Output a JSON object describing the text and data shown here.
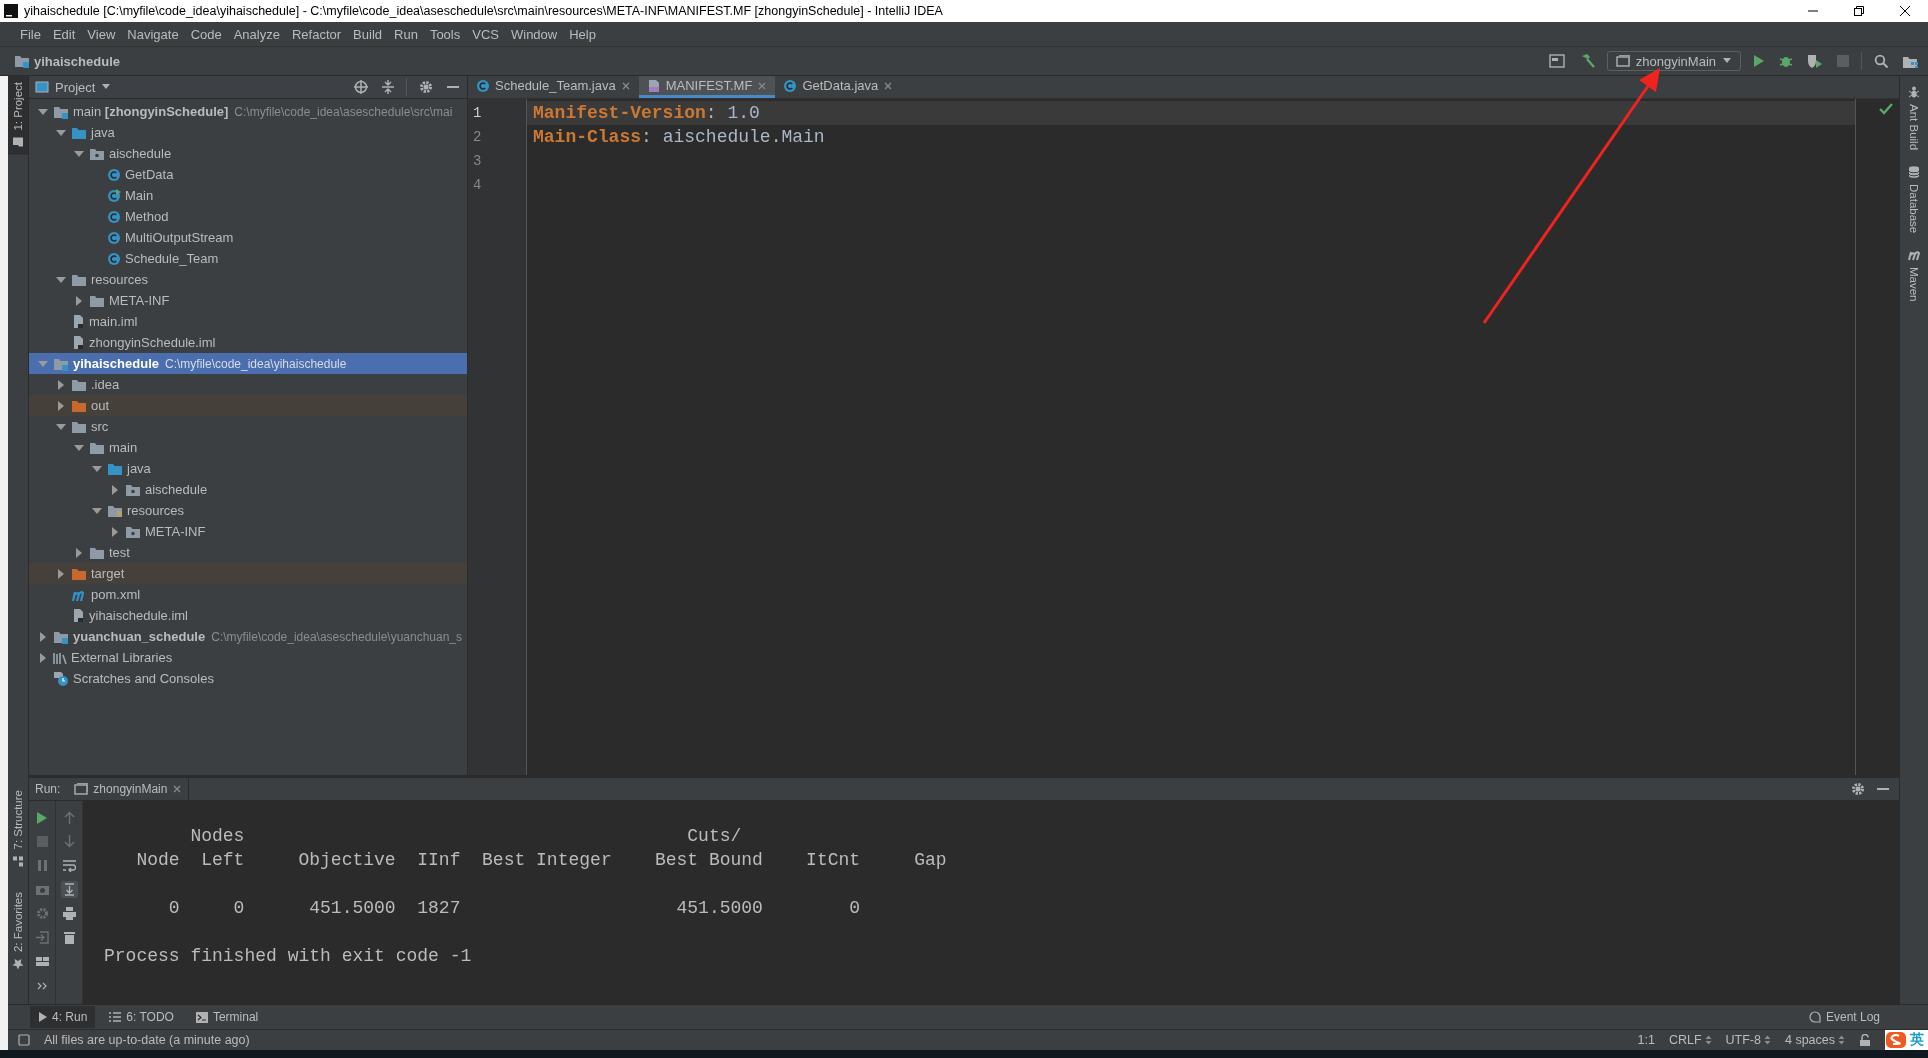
{
  "window": {
    "title": "yihaischedule [C:\\myfile\\code_idea\\yihaischedule] - C:\\myfile\\code_idea\\aseschedule\\src\\main\\resources\\META-INF\\MANIFEST.MF [zhongyinSchedule] - IntelliJ IDEA"
  },
  "menu": [
    "File",
    "Edit",
    "View",
    "Navigate",
    "Code",
    "Analyze",
    "Refactor",
    "Build",
    "Run",
    "Tools",
    "VCS",
    "Window",
    "Help"
  ],
  "nav_bar": {
    "project": "yihaischedule",
    "run_config": "zhongyinMain"
  },
  "left_tool_strip": [
    {
      "label": "1: Project",
      "selected": true,
      "kind": "project"
    },
    {
      "label": "7: Structure",
      "selected": false,
      "kind": "structure"
    },
    {
      "label": "2: Favorites",
      "selected": false,
      "kind": "favorites"
    }
  ],
  "project_panel": {
    "title": "Project",
    "tree": [
      {
        "label": "main **[zhongyinSchedule]**",
        "bold": false,
        "path": "C:\\myfile\\code_idea\\aseschedule\\src\\mai",
        "kind": "module",
        "expanded": true,
        "selected": false,
        "children": [
          {
            "label": "java",
            "kind": "source-folder",
            "expanded": true,
            "selected": false,
            "children": [
              {
                "label": "aischedule",
                "kind": "package",
                "expanded": true,
                "selected": false,
                "children": [
                  {
                    "label": "GetData",
                    "kind": "class",
                    "selected": false
                  },
                  {
                    "label": "Main",
                    "kind": "main-class",
                    "selected": false
                  },
                  {
                    "label": "Method",
                    "kind": "class",
                    "selected": false
                  },
                  {
                    "label": "MultiOutputStream",
                    "kind": "class",
                    "selected": false
                  },
                  {
                    "label": "Schedule_Team",
                    "kind": "class",
                    "selected": false
                  }
                ]
              }
            ]
          },
          {
            "label": "resources",
            "kind": "folder",
            "expanded": true,
            "selected": false,
            "children": [
              {
                "label": "META-INF",
                "kind": "folder",
                "expanded": false,
                "selected": false
              }
            ]
          },
          {
            "label": "main.iml",
            "kind": "iml",
            "selected": false
          },
          {
            "label": "zhongyinSchedule.iml",
            "kind": "iml",
            "selected": false
          }
        ]
      },
      {
        "label": "yihaischedule",
        "bold": true,
        "path": "C:\\myfile\\code_idea\\yihaischedule",
        "kind": "module",
        "expanded": true,
        "selected": true,
        "children": [
          {
            "label": ".idea",
            "kind": "folder",
            "expanded": false,
            "selected": false
          },
          {
            "label": "out",
            "kind": "excluded-folder",
            "expanded": false,
            "selected": false
          },
          {
            "label": "src",
            "kind": "folder",
            "expanded": true,
            "selected": false,
            "children": [
              {
                "label": "main",
                "kind": "folder",
                "expanded": true,
                "selected": false,
                "children": [
                  {
                    "label": "java",
                    "kind": "source-folder",
                    "expanded": true,
                    "selected": false,
                    "children": [
                      {
                        "label": "aischedule",
                        "kind": "package",
                        "expanded": false,
                        "selected": false
                      }
                    ]
                  },
                  {
                    "label": "resources",
                    "kind": "resources-folder",
                    "expanded": true,
                    "selected": false,
                    "children": [
                      {
                        "label": "META-INF",
                        "kind": "package",
                        "expanded": false,
                        "selected": false
                      }
                    ]
                  }
                ]
              },
              {
                "label": "test",
                "kind": "folder",
                "expanded": false,
                "selected": false
              }
            ]
          },
          {
            "label": "target",
            "kind": "excluded-folder",
            "expanded": false,
            "selected": false
          },
          {
            "label": "pom.xml",
            "kind": "maven",
            "selected": false
          },
          {
            "label": "yihaischedule.iml",
            "kind": "iml",
            "selected": false
          }
        ]
      },
      {
        "label": "yuanchuan_schedule",
        "bold": true,
        "path": "C:\\myfile\\code_idea\\aseschedule\\yuanchuan_s",
        "kind": "module",
        "expanded": false,
        "selected": false
      },
      {
        "label": "External Libraries",
        "kind": "libraries",
        "expanded": false,
        "selected": false
      },
      {
        "label": "Scratches and Consoles",
        "kind": "scratches",
        "selected": false
      }
    ]
  },
  "editor": {
    "tabs": [
      {
        "label": "Schedule_Team.java",
        "kind": "class",
        "selected": false
      },
      {
        "label": "MANIFEST.MF",
        "kind": "manifest",
        "selected": true
      },
      {
        "label": "GetData.java",
        "kind": "class",
        "selected": false
      }
    ],
    "lines": [
      {
        "number": "1",
        "key": "Manifest-Version",
        "rest": ": 1.0",
        "current": true
      },
      {
        "number": "2",
        "key": "Main-Class",
        "rest": ": aischedule.Main",
        "current": false
      },
      {
        "number": "3",
        "current": false
      },
      {
        "number": "4",
        "current": false
      }
    ]
  },
  "right_tool_strip": [
    {
      "label": "Ant Build",
      "kind": "ant"
    },
    {
      "label": "Database",
      "kind": "database"
    },
    {
      "label": "Maven",
      "kind": "maven"
    }
  ],
  "run_panel": {
    "label": "Run:",
    "tab": "zhongyinMain",
    "console": [
      {
        "lines": [
          "        Nodes                                         Cuts/",
          "   Node  Left     Objective  IInf  Best Integer    Best Bound    ItCnt     Gap"
        ]
      },
      {
        "lines": [
          "      0     0      451.5000  1827                    451.5000        0"
        ]
      },
      {
        "lines": [
          "Process finished with exit code -1"
        ]
      }
    ]
  },
  "bottom_tabs": [
    {
      "label": "4: Run",
      "kind": "run",
      "selected": true
    },
    {
      "label": "6: TODO",
      "kind": "todo",
      "selected": false
    },
    {
      "label": "Terminal",
      "kind": "terminal",
      "selected": false
    }
  ],
  "event_log": "Event Log",
  "status_bar": {
    "message": "All files are up-to-date (a minute ago)",
    "position": "1:1",
    "line_separator": "CRLF",
    "encoding": "UTF-8",
    "indent": "4 spaces",
    "input_method": "英"
  }
}
